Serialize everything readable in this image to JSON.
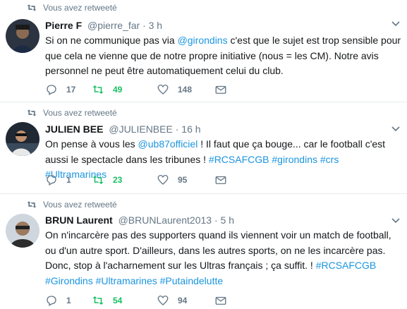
{
  "retweet_label": "Vous avez retweeté",
  "colors": {
    "accent": "#1b95e0",
    "retweet_green": "#17bf63",
    "muted": "#657786"
  },
  "tweets": [
    {
      "name": "Pierre F",
      "handle": "@pierre_far",
      "dot": "·",
      "time": "3 h",
      "body": [
        {
          "t": "Si on ne communique pas via "
        },
        {
          "t": "@girondins",
          "link": true
        },
        {
          "t": " c'est que le sujet est trop sensible pour que cela ne vienne que de notre propre initiative (nous = les CM). Notre avis personnel ne peut être automatiquement celui du club."
        }
      ],
      "replies": "17",
      "retweets": "49",
      "likes": "148"
    },
    {
      "name": "JULIEN BEE",
      "handle": "@JULIENBEE",
      "dot": "·",
      "time": "16 h",
      "body": [
        {
          "t": "On pense à vous les "
        },
        {
          "t": "@ub87officiel",
          "link": true
        },
        {
          "t": " ! Il faut que ça bouge... car le football c'est aussi le spectacle dans les tribunes ! "
        },
        {
          "t": "#RCSAFCGB",
          "link": true
        },
        {
          "t": " "
        },
        {
          "t": "#girondins",
          "link": true
        },
        {
          "t": " "
        },
        {
          "t": "#crs",
          "link": true
        },
        {
          "t": " "
        },
        {
          "t": "#Ultramarines",
          "link": true
        }
      ],
      "replies": "1",
      "retweets": "23",
      "likes": "95"
    },
    {
      "name": "BRUN Laurent",
      "handle": "@BRUNLaurent2013",
      "dot": "·",
      "time": "5 h",
      "body": [
        {
          "t": "On n'incarcère pas des supporters quand ils viennent voir un match de football, ou d'un autre sport. D'ailleurs, dans les autres sports, on ne les incarcère pas. Donc, stop à l'acharnement sur les Ultras français ; ça suffit. ! "
        },
        {
          "t": "#RCSAFCGB",
          "link": true
        },
        {
          "t": " "
        },
        {
          "t": "#Girondins",
          "link": true
        },
        {
          "t": " "
        },
        {
          "t": "#Ultramarines",
          "link": true
        },
        {
          "t": " "
        },
        {
          "t": "#Putaindelutte",
          "link": true
        }
      ],
      "replies": "1",
      "retweets": "54",
      "likes": "94"
    }
  ]
}
